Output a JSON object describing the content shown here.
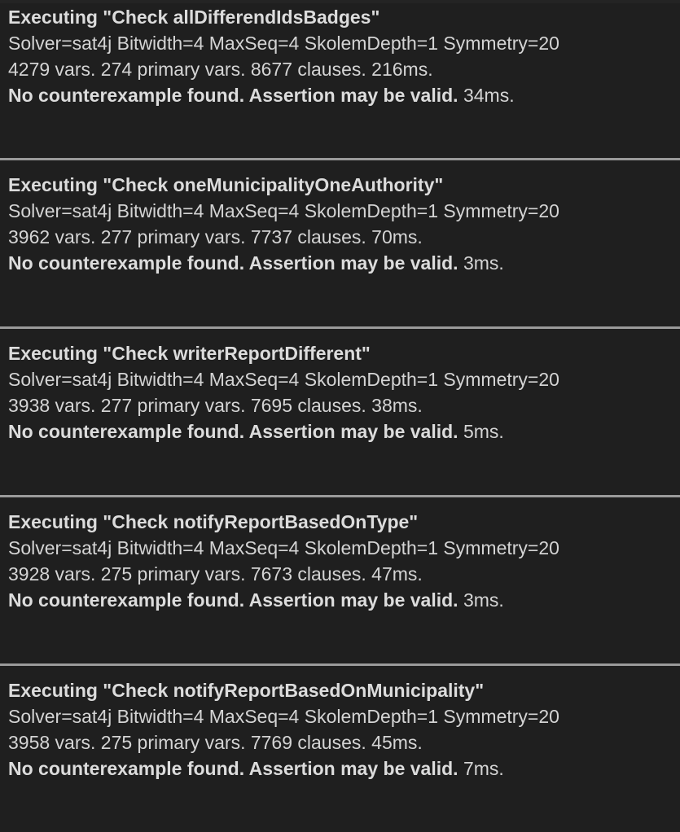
{
  "runs": [
    {
      "title": "Executing \"Check allDifferendIdsBadges\"",
      "solver_line": "Solver=sat4j Bitwidth=4 MaxSeq=4 SkolemDepth=1 Symmetry=20",
      "stats_line": "4279 vars. 274 primary vars. 8677 clauses. 216ms.",
      "result_bold": "No counterexample found. Assertion may be valid.",
      "result_time": " 34ms."
    },
    {
      "title": "Executing \"Check oneMunicipalityOneAuthority\"",
      "solver_line": "Solver=sat4j Bitwidth=4 MaxSeq=4 SkolemDepth=1 Symmetry=20",
      "stats_line": "3962 vars. 277 primary vars. 7737 clauses. 70ms.",
      "result_bold": "No counterexample found. Assertion may be valid.",
      "result_time": " 3ms."
    },
    {
      "title": "Executing \"Check writerReportDifferent\"",
      "solver_line": "Solver=sat4j Bitwidth=4 MaxSeq=4 SkolemDepth=1 Symmetry=20",
      "stats_line": "3938 vars. 277 primary vars. 7695 clauses. 38ms.",
      "result_bold": "No counterexample found. Assertion may be valid.",
      "result_time": " 5ms."
    },
    {
      "title": "Executing \"Check notifyReportBasedOnType\"",
      "solver_line": "Solver=sat4j Bitwidth=4 MaxSeq=4 SkolemDepth=1 Symmetry=20",
      "stats_line": "3928 vars. 275 primary vars. 7673 clauses. 47ms.",
      "result_bold": "No counterexample found. Assertion may be valid.",
      "result_time": " 3ms."
    },
    {
      "title": "Executing \"Check notifyReportBasedOnMunicipality\"",
      "solver_line": "Solver=sat4j Bitwidth=4 MaxSeq=4 SkolemDepth=1 Symmetry=20",
      "stats_line": "3958 vars. 275 primary vars. 7769 clauses. 45ms.",
      "result_bold": "No counterexample found. Assertion may be valid.",
      "result_time": " 7ms."
    }
  ],
  "colors": {
    "background": "#1f1f1f",
    "text": "#d4d4d4",
    "divider": "#9a9a9a"
  }
}
